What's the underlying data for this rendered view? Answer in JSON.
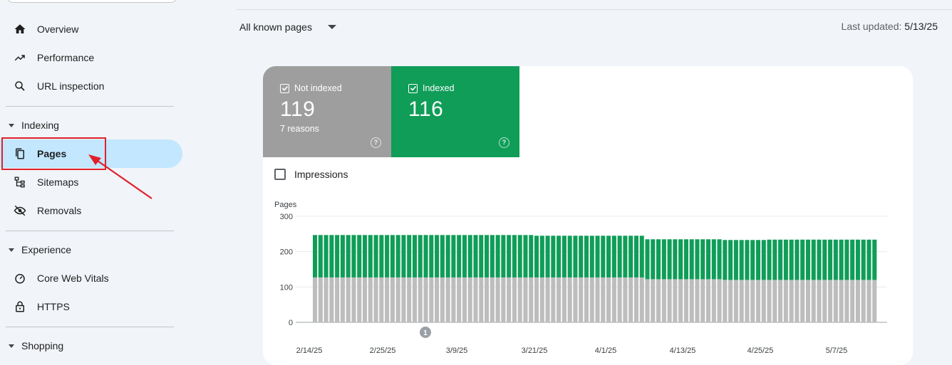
{
  "sidebar": {
    "items_top": [
      {
        "label": "Overview",
        "icon": "home-icon"
      },
      {
        "label": "Performance",
        "icon": "trending-up-icon"
      },
      {
        "label": "URL inspection",
        "icon": "search-icon"
      }
    ],
    "sections": [
      {
        "label": "Indexing",
        "items": [
          {
            "label": "Pages",
            "icon": "pages-icon",
            "active": true
          },
          {
            "label": "Sitemaps",
            "icon": "sitemap-icon"
          },
          {
            "label": "Removals",
            "icon": "eye-off-icon"
          }
        ]
      },
      {
        "label": "Experience",
        "items": [
          {
            "label": "Core Web Vitals",
            "icon": "speedometer-icon"
          },
          {
            "label": "HTTPS",
            "icon": "lock-icon"
          }
        ]
      },
      {
        "label": "Shopping",
        "items": []
      }
    ]
  },
  "header": {
    "filter_label": "All known pages",
    "last_updated_label": "Last updated:",
    "last_updated_value": "5/13/25"
  },
  "summary": {
    "not_indexed": {
      "label": "Not indexed",
      "value": "119",
      "sub": "7 reasons",
      "color": "#9e9e9e"
    },
    "indexed": {
      "label": "Indexed",
      "value": "116",
      "color": "#0f9d58"
    }
  },
  "impressions_label": "Impressions",
  "annotation_marker": "1",
  "chart_data": {
    "type": "bar",
    "stacked": true,
    "ylabel": "Pages",
    "ylim": [
      0,
      300
    ],
    "yticks": [
      "0",
      "100",
      "200",
      "300"
    ],
    "xtick_labels": [
      "2/14/25",
      "2/25/25",
      "3/9/25",
      "3/21/25",
      "4/1/25",
      "4/13/25",
      "4/25/25",
      "5/7/25"
    ],
    "grid": true,
    "series": [
      {
        "color": "#bdbdbd",
        "values": [
          127,
          127,
          127,
          127,
          127,
          127,
          127,
          127,
          127,
          127,
          127,
          127,
          127,
          127,
          127,
          127,
          127,
          127,
          127,
          127,
          127,
          127,
          127,
          127,
          127,
          127,
          127,
          127,
          127,
          127,
          127,
          127,
          127,
          127,
          127,
          127,
          127,
          127,
          127,
          127,
          127,
          127,
          127,
          127,
          127,
          127,
          127,
          127,
          127,
          127,
          127,
          127,
          127,
          127,
          127,
          127,
          127,
          127,
          127,
          127,
          122,
          122,
          122,
          122,
          122,
          122,
          122,
          122,
          122,
          122,
          122,
          122,
          122,
          122,
          120,
          120,
          120,
          120,
          120,
          120,
          120,
          120,
          120,
          120,
          120,
          120,
          120,
          120,
          120,
          120,
          120,
          120,
          120,
          120,
          120,
          120,
          120,
          120,
          120,
          120,
          120,
          120
        ]
      },
      {
        "color": "#0f9d58",
        "values": [
          120,
          120,
          120,
          120,
          120,
          120,
          120,
          120,
          120,
          120,
          120,
          120,
          120,
          120,
          120,
          120,
          120,
          120,
          120,
          120,
          120,
          120,
          120,
          120,
          120,
          120,
          120,
          120,
          120,
          120,
          120,
          120,
          120,
          120,
          120,
          120,
          120,
          120,
          120,
          120,
          118,
          118,
          118,
          118,
          118,
          118,
          118,
          118,
          118,
          118,
          118,
          118,
          118,
          118,
          118,
          118,
          118,
          118,
          118,
          118,
          113,
          113,
          113,
          113,
          113,
          113,
          113,
          113,
          113,
          113,
          113,
          113,
          113,
          113,
          113,
          113,
          113,
          113,
          113,
          113,
          113,
          113,
          114,
          114,
          114,
          114,
          114,
          114,
          114,
          114,
          114,
          114,
          114,
          114,
          114,
          114,
          114,
          114,
          114,
          114,
          114,
          114
        ]
      }
    ]
  }
}
